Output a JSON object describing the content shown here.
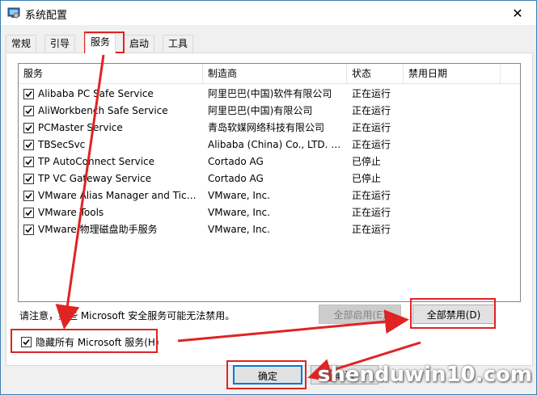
{
  "window": {
    "title": "系统配置",
    "close_glyph": "✕"
  },
  "tabs": [
    "常规",
    "引导",
    "服务",
    "启动",
    "工具"
  ],
  "active_tab": "服务",
  "columns": [
    "服务",
    "制造商",
    "状态",
    "禁用日期"
  ],
  "services": [
    {
      "name": "Alibaba PC Safe Service",
      "maker": "阿里巴巴(中国)软件有限公司",
      "status": "正在运行",
      "disabled_date": "",
      "checked": true
    },
    {
      "name": "AliWorkbench Safe Service",
      "maker": "阿里巴巴(中国)有限公司",
      "status": "正在运行",
      "disabled_date": "",
      "checked": true
    },
    {
      "name": "PCMaster Service",
      "maker": "青岛软媒网络科技有限公司",
      "status": "正在运行",
      "disabled_date": "",
      "checked": true
    },
    {
      "name": "TBSecSvc",
      "maker": "Alibaba (China) Co., LTD. A...",
      "status": "正在运行",
      "disabled_date": "",
      "checked": true
    },
    {
      "name": "TP AutoConnect Service",
      "maker": "Cortado AG",
      "status": "已停止",
      "disabled_date": "",
      "checked": true
    },
    {
      "name": "TP VC Gateway Service",
      "maker": "Cortado AG",
      "status": "已停止",
      "disabled_date": "",
      "checked": true
    },
    {
      "name": "VMware Alias Manager and Tick...",
      "maker": "VMware, Inc.",
      "status": "正在运行",
      "disabled_date": "",
      "checked": true
    },
    {
      "name": "VMware Tools",
      "maker": "VMware, Inc.",
      "status": "正在运行",
      "disabled_date": "",
      "checked": true
    },
    {
      "name": "VMware 物理磁盘助手服务",
      "maker": "VMware, Inc.",
      "status": "正在运行",
      "disabled_date": "",
      "checked": true
    }
  ],
  "notice": "请注意，某些 Microsoft 安全服务可能无法禁用。",
  "buttons": {
    "enable_all": "全部启用(E)",
    "disable_all": "全部禁用(D)",
    "ok": "确定",
    "cancel": "取消"
  },
  "hide_microsoft": {
    "label": "隐藏所有 Microsoft 服务(H)",
    "checked": true
  },
  "watermark": "shenduwin10.com",
  "colors": {
    "annotation_red": "#e02323",
    "accent_blue": "#3c7fb1"
  }
}
